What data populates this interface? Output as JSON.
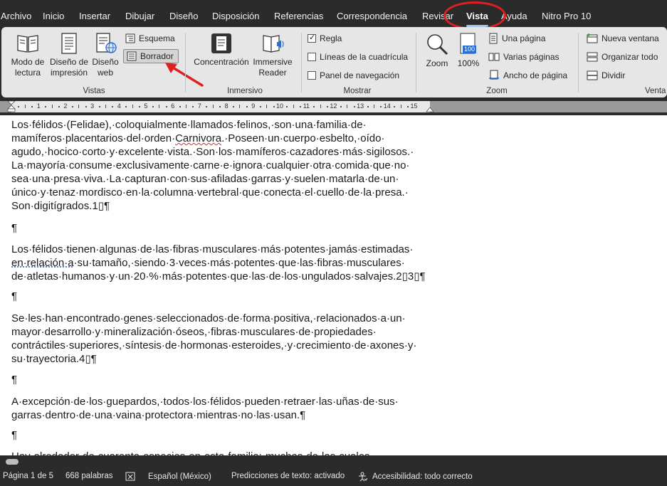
{
  "menu": {
    "tabs": [
      "Archivo",
      "Inicio",
      "Insertar",
      "Dibujar",
      "Diseño",
      "Disposición",
      "Referencias",
      "Correspondencia",
      "Revisar",
      "Vista",
      "Ayuda",
      "Nitro Pro 10"
    ],
    "active": "Vista"
  },
  "ribbon": {
    "vistas": {
      "label": "Vistas",
      "modo_lectura": "Modo de lectura",
      "diseno_impresion": "Diseño de impresión",
      "diseno_web": "Diseño web",
      "esquema": "Esquema",
      "borrador": "Borrador"
    },
    "inmersivo": {
      "label": "Inmersivo",
      "concentracion": "Concentración",
      "immersive_reader": "Immersive Reader"
    },
    "mostrar": {
      "label": "Mostrar",
      "regla": "Regla",
      "regla_checked": true,
      "lineas": "Líneas de la cuadrícula",
      "lineas_checked": false,
      "panel": "Panel de navegación",
      "panel_checked": false
    },
    "zoom": {
      "label": "Zoom",
      "zoom": "Zoom",
      "cien": "100%",
      "icon_value": "100",
      "una_pagina": "Una página",
      "varias_paginas": "Varias páginas",
      "ancho_pagina": "Ancho de página"
    },
    "ventana": {
      "label": "Venta",
      "nueva": "Nueva ventana",
      "organizar": "Organizar todo",
      "dividir": "Dividir"
    }
  },
  "ruler": {
    "numbers": [
      "1",
      "2",
      "3",
      "4",
      "5",
      "6",
      "7",
      "8",
      "9",
      "10",
      "11",
      "12",
      "13",
      "14",
      "15"
    ]
  },
  "document": {
    "p1": [
      "Los·félidos·(Felidae),·coloquialmente·llamados·felinos,·son·una·familia·de·",
      "mamíferos·placentarios·del·orden·Carnivora.·Poseen·un·cuerpo·esbelto,·oído·",
      "agudo,·hocico·corto·y·excelente·vista.·Son·los·mamíferos·cazadores·más·sigilosos.·",
      "La·mayoría·consume·exclusivamente·carne·e·ignora·cualquier·otra·comida·que·no·",
      "sea·una·presa·viva.·La·capturan·con·sus·afiladas·garras·y·suelen·matarla·de·un·",
      "único·y·tenaz·mordisco·en·la·columna·vertebral·que·conecta·el·cuello·de·la·presa.·",
      "Son·digitígrados.1▯¶"
    ],
    "p2": [
      "Los·félidos·tienen·algunas·de·las·fibras·musculares·más·potentes·jamás·estimadas·",
      "en·relación·a·su·tamaño,·siendo·3·veces·más·potentes·que·las·fibras·musculares·",
      "de·atletas·humanos·y·un·20·%·más·potentes·que·las·de·los·ungulados·salvajes.2▯3▯¶"
    ],
    "p3": [
      "Se·les·han·encontrado·genes·seleccionados·de·forma·positiva,·relacionados·a·un·",
      "mayor·desarrollo·y·mineralización·óseos,·fibras·musculares·de·propiedades·",
      "contráctiles·superiores,·síntesis·de·hormonas·esteroides,·y·crecimiento·de·axones·y·",
      "su·trayectoria.4▯¶"
    ],
    "p4": [
      "A·excepción·de·los·guepardos,·todos·los·félidos·pueden·retraer·las·uñas·de·sus·",
      "garras·dentro·de·una·vaina·protectora·mientras·no·las·usan.¶"
    ],
    "p5_partial": "Hay·alrededor·de·cuarenta·especies·en·esta·familia;·muchas·de·las·cuales",
    "pilcrow": "¶"
  },
  "status": {
    "page": "Página 1 de 5",
    "words": "668 palabras",
    "language": "Español (México)",
    "predictions": "Predicciones de texto: activado",
    "accessibility": "Accesibilidad: todo correcto"
  },
  "colors": {
    "chrome": "#2b2b2b",
    "ribbon": "#e6e6e6",
    "annotation_red": "#e02020",
    "active_underline": "#9ec6ff"
  }
}
